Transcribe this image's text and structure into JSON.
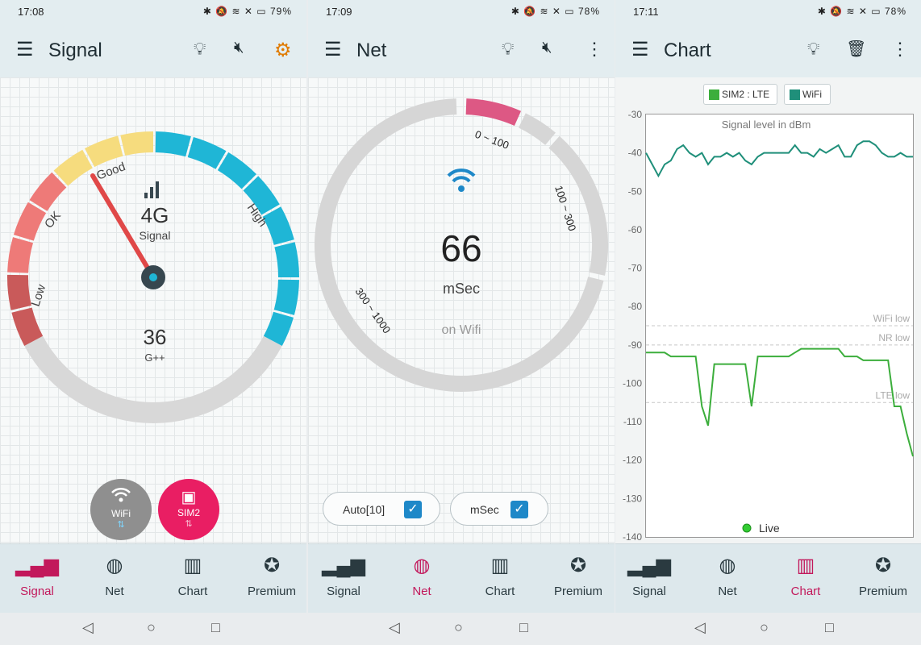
{
  "signal_screen": {
    "status": {
      "time": "17:08",
      "icons": "✱ 🔕 ≋ ✕ ▭ 79%"
    },
    "appbar": {
      "title": "Signal"
    },
    "gauge": {
      "tech_label": "4G",
      "sublabel": "Signal",
      "value": "36",
      "value_unit": "G++",
      "zones": [
        "Low",
        "OK",
        "Good",
        "High"
      ]
    },
    "fabs": {
      "wifi": "WiFi",
      "sim": "SIM2"
    }
  },
  "net_screen": {
    "status": {
      "time": "17:09",
      "icons": "✱ 🔕 ≋ ✕ ▭ 78%"
    },
    "appbar": {
      "title": "Net"
    },
    "gauge": {
      "value": "66",
      "unit": "mSec",
      "network": "on Wifi",
      "ranges": [
        "0 ~ 100",
        "100 ~ 300",
        "300 ~ 1000"
      ]
    },
    "options": {
      "auto": "Auto[10]",
      "msec": "mSec"
    }
  },
  "chart_screen": {
    "status": {
      "time": "17:11",
      "icons": "✱ 🔕 ≋ ✕ ▭ 78%"
    },
    "appbar": {
      "title": "Chart"
    },
    "legend": {
      "sim": "SIM2 : LTE",
      "wifi": "WiFi"
    },
    "live": "Live",
    "thresholds": {
      "wifi": "WiFi low",
      "nr": "NR low",
      "lte": "LTE low"
    }
  },
  "bottom_nav": [
    "Signal",
    "Net",
    "Chart",
    "Premium"
  ],
  "colors": {
    "accent": "#c2185b",
    "wifi_line": "#1f8f7a",
    "lte_line": "#3cae3c",
    "gauge_blue": "#1fb6d6"
  },
  "chart_data": {
    "type": "line",
    "title": "Signal level in dBm",
    "ylim": [
      -140,
      -30
    ],
    "yticks": [
      -30,
      -40,
      -50,
      -60,
      -70,
      -80,
      -90,
      -100,
      -110,
      -120,
      -130,
      -140
    ],
    "threshold_values": {
      "WiFi low": -85,
      "NR low": -90,
      "LTE low": -105
    },
    "series": [
      {
        "name": "WiFi",
        "values": [
          -40,
          -43,
          -46,
          -43,
          -42,
          -39,
          -38,
          -40,
          -41,
          -40,
          -43,
          -41,
          -41,
          -40,
          -41,
          -40,
          -42,
          -43,
          -41,
          -40,
          -40,
          -40,
          -40,
          -40,
          -38,
          -40,
          -40,
          -41,
          -39,
          -40,
          -39,
          -38,
          -41,
          -41,
          -38,
          -37,
          -37,
          -38,
          -40,
          -41,
          -41,
          -40,
          -41,
          -41
        ]
      },
      {
        "name": "SIM2 : LTE",
        "values": [
          -92,
          -92,
          -92,
          -92,
          -93,
          -93,
          -93,
          -93,
          -93,
          -106,
          -111,
          -95,
          -95,
          -95,
          -95,
          -95,
          -95,
          -106,
          -93,
          -93,
          -93,
          -93,
          -93,
          -93,
          -92,
          -91,
          -91,
          -91,
          -91,
          -91,
          -91,
          -91,
          -93,
          -93,
          -93,
          -94,
          -94,
          -94,
          -94,
          -94,
          -106,
          -106,
          -113,
          -119
        ]
      }
    ]
  }
}
